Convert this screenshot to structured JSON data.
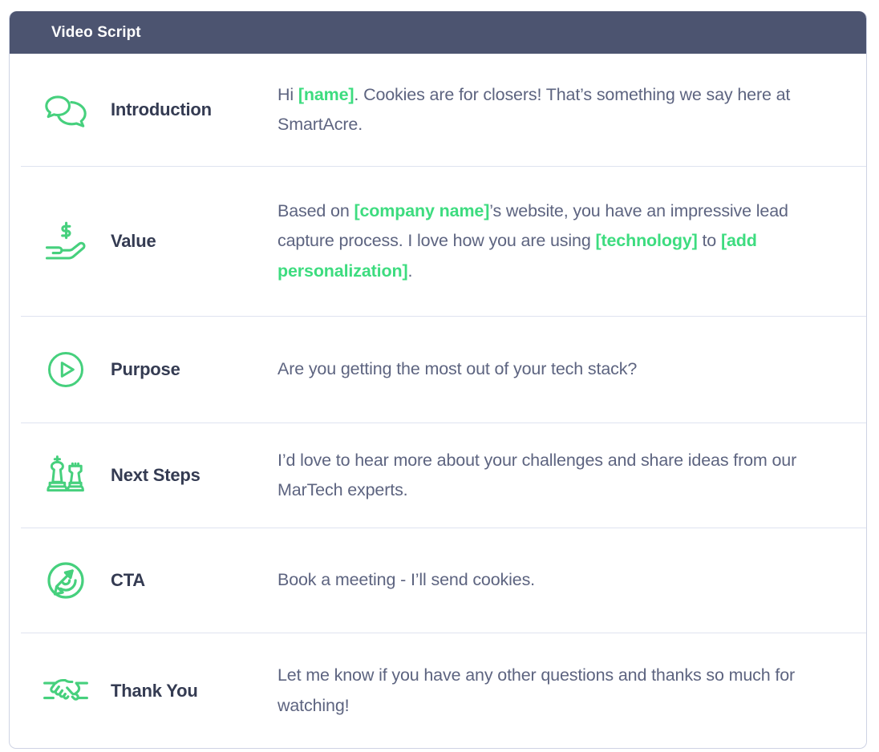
{
  "header": {
    "title": "Video Script"
  },
  "colors": {
    "header_bg": "#4c5470",
    "accent_green": "#3ddc7f",
    "label_text": "#343b52",
    "body_text": "#5d6480",
    "divider": "#dfe3f0",
    "card_bg": "#ffffff"
  },
  "rows": [
    {
      "icon": "speech-bubbles-icon",
      "label": "Introduction",
      "segments": [
        {
          "text": "Hi ",
          "token": false
        },
        {
          "text": "[name]",
          "token": true
        },
        {
          "text": ". Cookies are for closers! That’s something we say here at SmartAcre.",
          "token": false
        }
      ]
    },
    {
      "icon": "hand-holding-dollar-icon",
      "label": "Value",
      "segments": [
        {
          "text": "Based on ",
          "token": false
        },
        {
          "text": "[company name]",
          "token": true
        },
        {
          "text": "’s website, you have an impressive lead capture process. I love how you are using ",
          "token": false
        },
        {
          "text": "[technology]",
          "token": true
        },
        {
          "text": " to ",
          "token": false
        },
        {
          "text": "[add personalization]",
          "token": true
        },
        {
          "text": ".",
          "token": false
        }
      ]
    },
    {
      "icon": "play-circle-icon",
      "label": "Purpose",
      "segments": [
        {
          "text": "Are you getting the most out of your tech stack?",
          "token": false
        }
      ]
    },
    {
      "icon": "chess-pieces-icon",
      "label": "Next Steps",
      "segments": [
        {
          "text": "I’d love to hear more about your challenges and share ideas from our MarTech experts.",
          "token": false
        }
      ]
    },
    {
      "icon": "target-cursor-icon",
      "label": "CTA",
      "segments": [
        {
          "text": "Book a meeting - I’ll send cookies.",
          "token": false
        }
      ]
    },
    {
      "icon": "handshake-icon",
      "label": "Thank You",
      "segments": [
        {
          "text": "Let me know if you have any other questions and thanks so much for watching!",
          "token": false
        }
      ]
    }
  ]
}
